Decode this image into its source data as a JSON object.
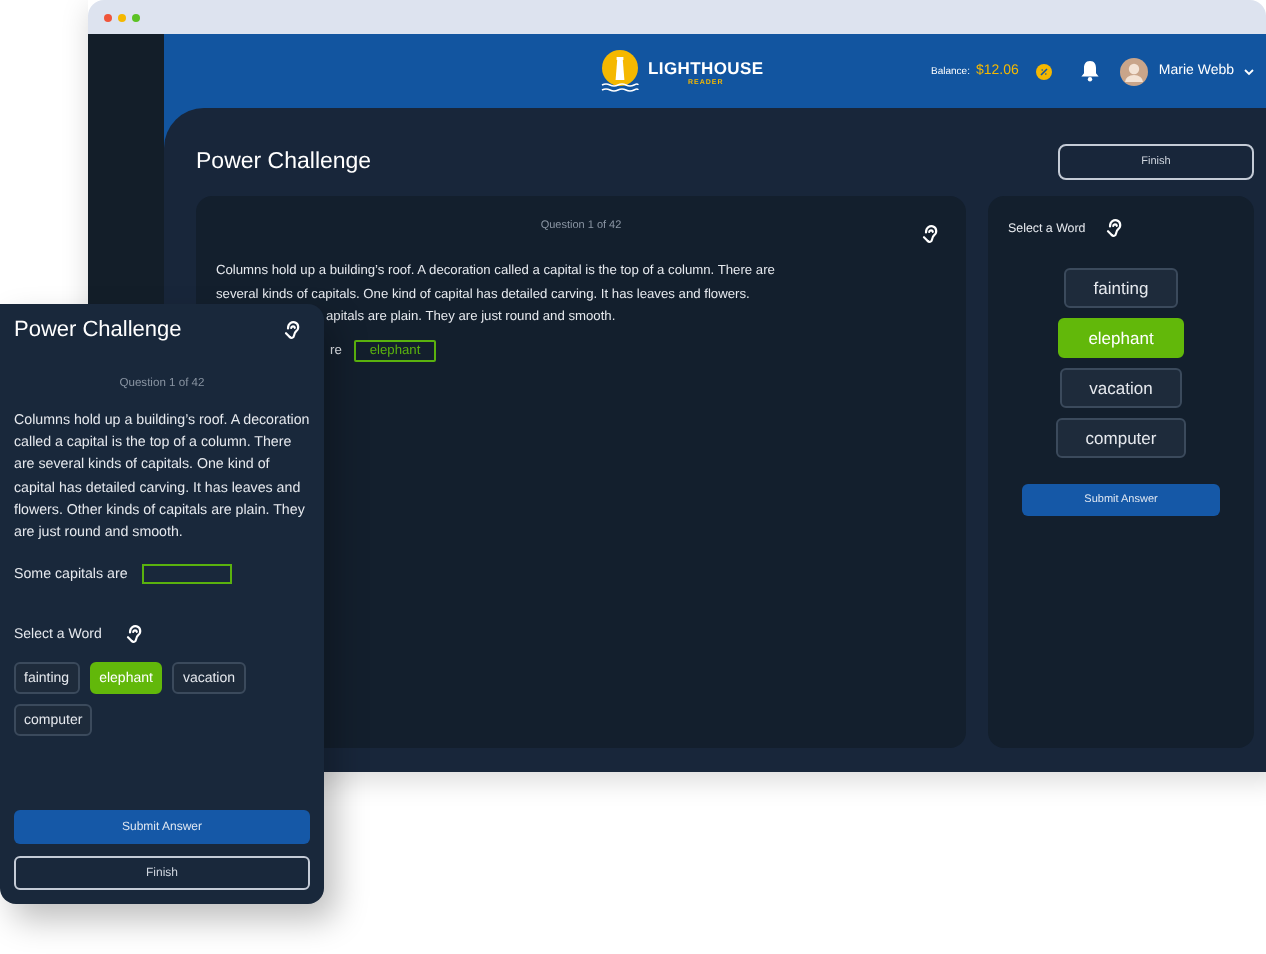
{
  "browser": {
    "dots": [
      {
        "color": "#f0553a"
      },
      {
        "color": "#f5b800"
      },
      {
        "color": "#5cc224"
      }
    ]
  },
  "header": {
    "logo_title": "LIGHTHOUSE",
    "logo_subtitle": "READER",
    "balance_label": "Balance:",
    "balance_value": "$12.06",
    "user_name": "Marie Webb"
  },
  "desktop": {
    "title": "Power Challenge",
    "finish_button": "Finish",
    "question_counter": "Question 1 of 42",
    "passage_lines": [
      {
        "kind": "full",
        "text": "Columns hold up a building’s roof. A decoration called a capital is the top of a column. There are"
      },
      {
        "kind": "full",
        "text": "several kinds of capitals. One kind of capital has detailed carving. It has leaves and flowers."
      },
      {
        "kind": "cut",
        "text": "apitals are plain. They are just round and smooth."
      }
    ],
    "prompt_fragment": "re",
    "answer": "elephant",
    "select_label": "Select a Word",
    "words": [
      {
        "label": "fainting",
        "selected": false
      },
      {
        "label": "elephant",
        "selected": true
      },
      {
        "label": "vacation",
        "selected": false
      },
      {
        "label": "computer",
        "selected": false
      }
    ],
    "submit_button": "Submit Answer"
  },
  "mobile": {
    "title": "Power Challenge",
    "question_counter": "Question 1 of 42",
    "passage": "Columns hold up a building’s roof. A decoration called a capital is the top of a column. There are several kinds of capitals. One kind of capital has detailed carving. It has leaves and flowers. Other kinds of capitals are plain. They are just round and smooth.",
    "prompt": "Some capitals are",
    "select_label": "Select a Word",
    "words": [
      {
        "label": "fainting",
        "selected": false
      },
      {
        "label": "elephant",
        "selected": true
      },
      {
        "label": "vacation",
        "selected": false
      },
      {
        "label": "computer",
        "selected": false
      }
    ],
    "submit_button": "Submit Answer",
    "finish_button": "Finish"
  }
}
